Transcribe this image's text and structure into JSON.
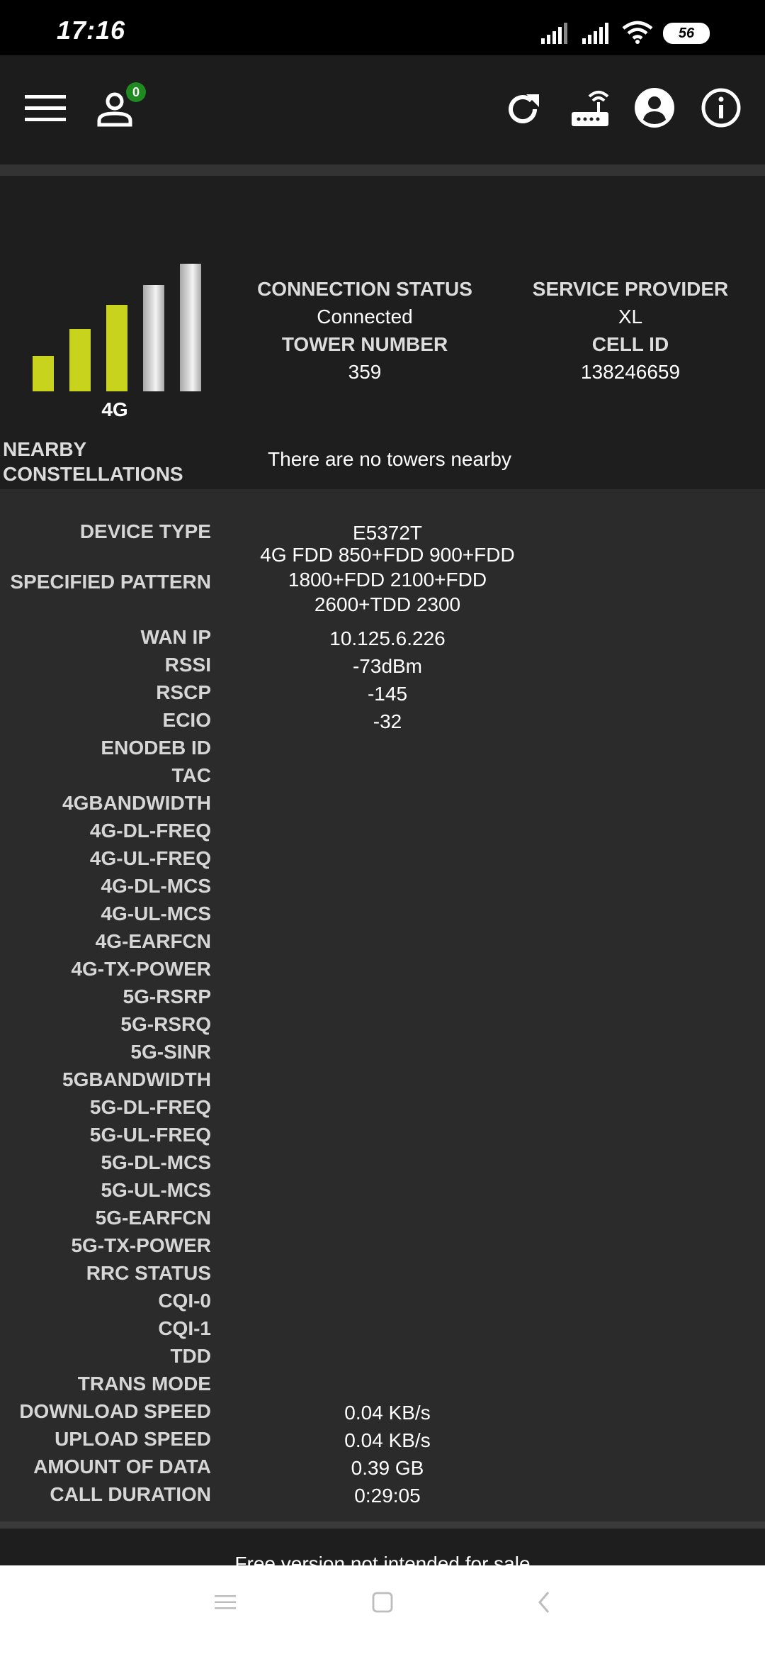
{
  "status_bar": {
    "time": "17:16",
    "battery": "56",
    "icons": [
      "signal-icon",
      "signal-icon",
      "wifi-icon",
      "battery-icon"
    ]
  },
  "app_bar": {
    "user_badge": "0",
    "icons": [
      "menu-icon",
      "user-icon",
      "refresh-icon",
      "router-icon",
      "account-icon",
      "info-icon"
    ]
  },
  "signal": {
    "network_type": "4G",
    "level_bars_active": 3,
    "level_bars_total": 5,
    "active_color": "#c8d31e",
    "inactive_color": "#d8d8d8"
  },
  "connection": {
    "status_label": "CONNECTION STATUS",
    "status_value": "Connected",
    "tower_label": "TOWER NUMBER",
    "tower_value": "359",
    "provider_label": "SERVICE PROVIDER",
    "provider_value": "XL",
    "cell_label": "CELL ID",
    "cell_value": "138246659"
  },
  "nearby": {
    "label_line1": "NEARBY",
    "label_line2": "CONSTELLATIONS",
    "message": "There are no towers nearby"
  },
  "details": [
    {
      "label": "DEVICE TYPE",
      "value": "E5372T"
    },
    {
      "label": "SPECIFIED PATTERN",
      "value": "4G FDD 850+FDD 900+FDD 1800+FDD 2100+FDD 2600+TDD 2300"
    },
    {
      "label": "WAN IP",
      "value": "10.125.6.226"
    },
    {
      "label": "RSSI",
      "value": "-73dBm"
    },
    {
      "label": "RSCP",
      "value": "-145"
    },
    {
      "label": "ECIO",
      "value": "-32"
    },
    {
      "label": "ENODEB ID",
      "value": ""
    },
    {
      "label": "TAC",
      "value": ""
    },
    {
      "label": "4GBANDWIDTH",
      "value": ""
    },
    {
      "label": "4G-DL-FREQ",
      "value": ""
    },
    {
      "label": "4G-UL-FREQ",
      "value": ""
    },
    {
      "label": "4G-DL-MCS",
      "value": ""
    },
    {
      "label": "4G-UL-MCS",
      "value": ""
    },
    {
      "label": "4G-EARFCN",
      "value": ""
    },
    {
      "label": "4G-TX-POWER",
      "value": ""
    },
    {
      "label": "5G-RSRP",
      "value": ""
    },
    {
      "label": "5G-RSRQ",
      "value": ""
    },
    {
      "label": "5G-SINR",
      "value": ""
    },
    {
      "label": "5GBANDWIDTH",
      "value": ""
    },
    {
      "label": "5G-DL-FREQ",
      "value": ""
    },
    {
      "label": "5G-UL-FREQ",
      "value": ""
    },
    {
      "label": "5G-DL-MCS",
      "value": ""
    },
    {
      "label": "5G-UL-MCS",
      "value": ""
    },
    {
      "label": "5G-EARFCN",
      "value": ""
    },
    {
      "label": "5G-TX-POWER",
      "value": ""
    },
    {
      "label": "RRC STATUS",
      "value": ""
    },
    {
      "label": "CQI-0",
      "value": ""
    },
    {
      "label": "CQI-1",
      "value": ""
    },
    {
      "label": "TDD",
      "value": ""
    },
    {
      "label": "TRANS MODE",
      "value": ""
    },
    {
      "label": "DOWNLOAD SPEED",
      "value": "0.04 KB/s"
    },
    {
      "label": "UPLOAD SPEED",
      "value": "0.04 KB/s"
    },
    {
      "label": "AMOUNT OF DATA",
      "value": "0.39 GB"
    },
    {
      "label": "CALL DURATION",
      "value": "0:29:05"
    }
  ],
  "footer": {
    "text": "Free version not intended for sale"
  },
  "nav_bar": {
    "icons": [
      "recents-icon",
      "home-icon",
      "back-icon"
    ]
  }
}
